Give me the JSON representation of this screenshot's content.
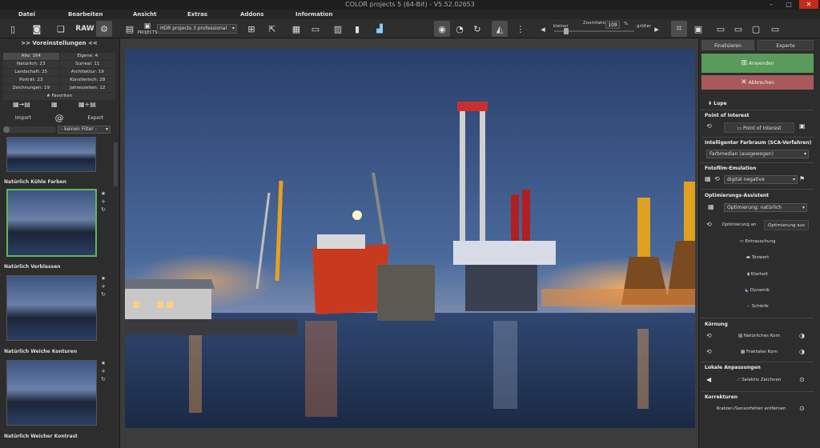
{
  "window": {
    "title": "COLOR projects 5 (64-Bit) - V5.52.02653",
    "minimize": "–",
    "maximize": "□",
    "close": "✕"
  },
  "menu": [
    "Datei",
    "Bearbeiten",
    "Ansicht",
    "Extras",
    "Addons",
    "Information"
  ],
  "toolbar": {
    "raw": "RAW",
    "projects": "PROJECTS",
    "preset": "HDR projects 3 professional",
    "zoom_small": "kleiner",
    "zoom_label": "Zoomfaktor",
    "zoom_value": "109",
    "zoom_unit": "%",
    "zoom_big": "größer"
  },
  "left": {
    "title": ">> Voreinstellungen <<",
    "tags": [
      [
        "Alle: 164",
        "Eigene: 4"
      ],
      [
        "Natürlich: 23",
        "Surreal: 11"
      ],
      [
        "Landschaft: 25",
        "Architektur: 19"
      ],
      [
        "Porträt: 23",
        "Künstlerisch: 28"
      ],
      [
        "Zeichnungen: 19",
        "Jahreszeiten: 12"
      ]
    ],
    "favorites": "Favoriten",
    "import": "Import",
    "at": "@",
    "export": "Export",
    "filter": "- keinen Filter -",
    "presets": [
      "Natürlich Kühle Farben",
      "Natürlich Verblassen",
      "Natürlich Weiche Konturen",
      "Natürlich Weicher Kontrast"
    ]
  },
  "right": {
    "tabs": [
      "Finalisieren",
      "Experte"
    ],
    "apply": "Anwenden",
    "cancel": "Abbrechen",
    "lupe": "Lupe",
    "poi": {
      "title": "Point of Interest",
      "button": "Point of Interest"
    },
    "sca": {
      "title": "Intelligenter Farbraum (SCA-Verfahren)",
      "value": "Farbmedian (ausgewogen)"
    },
    "film": {
      "title": "Fotofilm-Emulation",
      "value": "digital negative"
    },
    "opt": {
      "title": "Optimierungs-Assistent",
      "value": "Optimierung: natürlich",
      "on": "Optimierung an",
      "off": "Optimierung aus"
    },
    "tools": [
      "Entrauschung",
      "Tonwert",
      "Klarheit",
      "Dynamik",
      "Schärfe"
    ],
    "grain": {
      "title": "Körnung",
      "items": [
        "Natürliches Korn",
        "Fraktales Korn"
      ]
    },
    "local": {
      "title": "Lokale Anpassungen",
      "item": "Selektiv Zeichnen"
    },
    "corr": {
      "title": "Korrekturen",
      "item": "Kratzer-/Sensorfehler entfernen"
    }
  },
  "colors": {
    "accent_green": "#5cb85c",
    "apply_bg": "#5a9a5a",
    "cancel_bg": "#a85a5a"
  }
}
